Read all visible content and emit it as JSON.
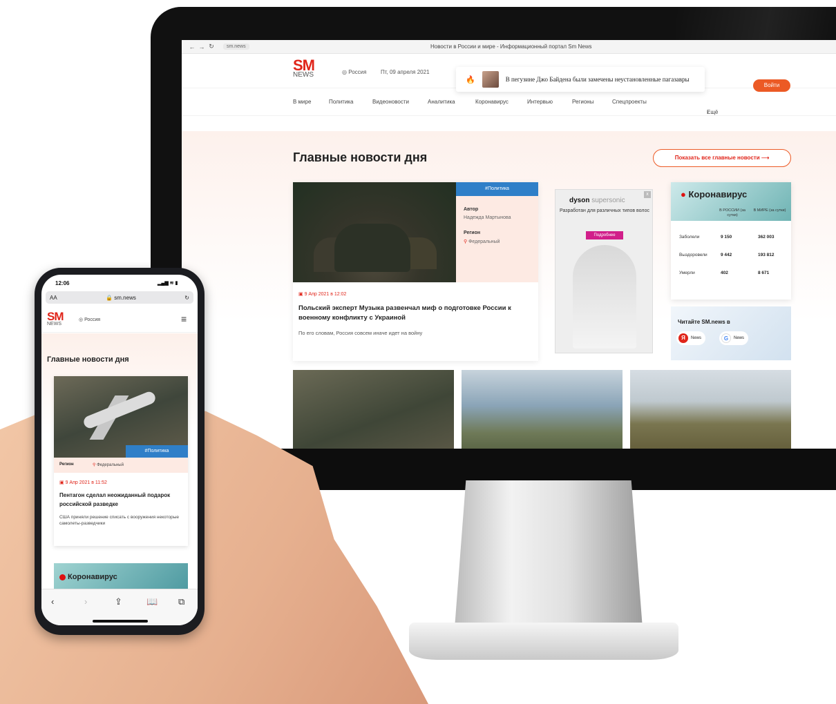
{
  "desktop": {
    "browser": {
      "url": "sm.news",
      "title": "Новости в России и мире - Информационный портал Sm News"
    },
    "header": {
      "logo_top": "SM",
      "logo_bottom": "NEWS",
      "location": "Россия",
      "date": "Пт, 09 апреля 2021",
      "ticker": "В пегузине Джо Байдена были замечены неустановленные пагазавры",
      "login_label": "Войти"
    },
    "menu": [
      "В мире",
      "Политика",
      "Видеоновости",
      "Аналитика",
      "Коронавирус",
      "Интервью",
      "Регионы",
      "Спецпроекты"
    ],
    "menu_more": "Ещё",
    "section_title": "Главные новости дня",
    "show_all": "Показать все главные новости",
    "main_card": {
      "tag": "#Политика",
      "author_label": "Автор",
      "author": "Надежда Мартынова",
      "region_label": "Регион",
      "region": "Федеральный",
      "date": "9 Апр 2021 в 12:02",
      "headline": "Польский эксперт Музыка развенчал миф о подготовке России к военному конфликту с Украиной",
      "lead": "По его словам, Россия совсем иначе идет на войну"
    },
    "ad": {
      "brand": "dyson",
      "brand_sub": "supersonic",
      "text": "Разработан для различных типов волос",
      "button": "Подробнее",
      "close": "x"
    },
    "covid": {
      "title": "Коронавирус",
      "col1": "В РОССИИ (за сутки)",
      "col2": "В МИРЕ (за сутки)",
      "rows": [
        {
          "label": "Заболели",
          "ru": "9 150",
          "world": "362 003"
        },
        {
          "label": "Выздоровели",
          "ru": "9 442",
          "world": "193 812"
        },
        {
          "label": "Умерли",
          "ru": "402",
          "world": "8 671"
        }
      ]
    },
    "readus": {
      "text": "Читайте SM.news в",
      "yandex": "News",
      "google": "News"
    }
  },
  "mobile": {
    "time": "12:06",
    "signal": "▂▄▆ ≋ ▮",
    "aa": "AA",
    "url": "🔒 sm.news",
    "reload": "↻",
    "location": "Россия",
    "section_title": "Главные новости дня",
    "card": {
      "tag": "#Политика",
      "region_label": "Регион",
      "region": "Федеральный",
      "date": "9 Апр 2021 в 11:52",
      "headline": "Пентагон сделал неожиданный подарок российской разведке",
      "lead": "США приняли решение списать с вооружения некоторые самолеты-разведчики"
    },
    "covid_title": "Коронавирус"
  },
  "colors": {
    "accent": "#e0251a",
    "orange": "#ec5a25",
    "tag_blue": "#2f7fc8"
  }
}
